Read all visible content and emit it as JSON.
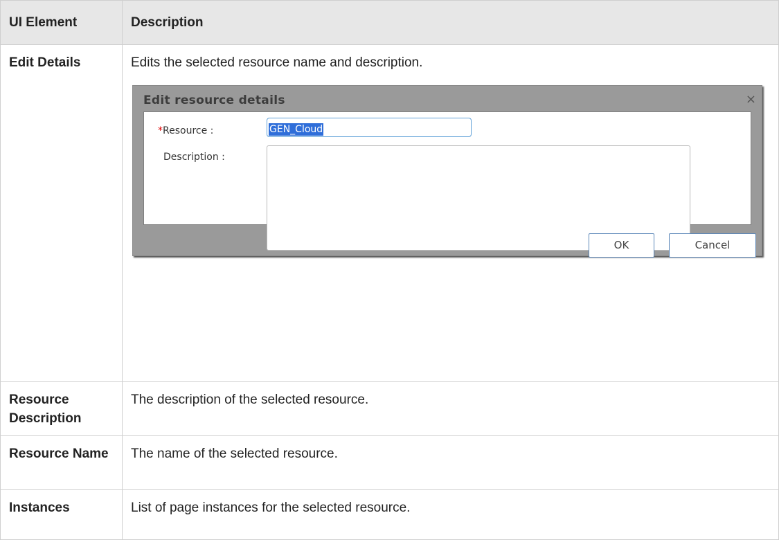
{
  "header": {
    "col_element": "UI Element",
    "col_description": "Description"
  },
  "rows": [
    {
      "element": "Edit Details",
      "description": "Edits the selected resource name and description."
    },
    {
      "element": "Resource Description",
      "description": "The description of the selected resource."
    },
    {
      "element": "Resource Name",
      "description": "The name of the selected resource."
    },
    {
      "element": "Instances",
      "description": "List of page instances for the selected resource."
    }
  ],
  "dialog": {
    "title": "Edit resource details",
    "close_icon": "×",
    "required_mark": "*",
    "resource_label": "Resource :",
    "resource_value": "GEN_Cloud",
    "description_label": "Description :",
    "description_value": "",
    "ok_label": "OK",
    "cancel_label": "Cancel",
    "colors": {
      "frame": "#9a9a9a",
      "input_focus_border": "#5fa0d8",
      "selection": "#2f6ed9",
      "required": "#e00000"
    }
  }
}
